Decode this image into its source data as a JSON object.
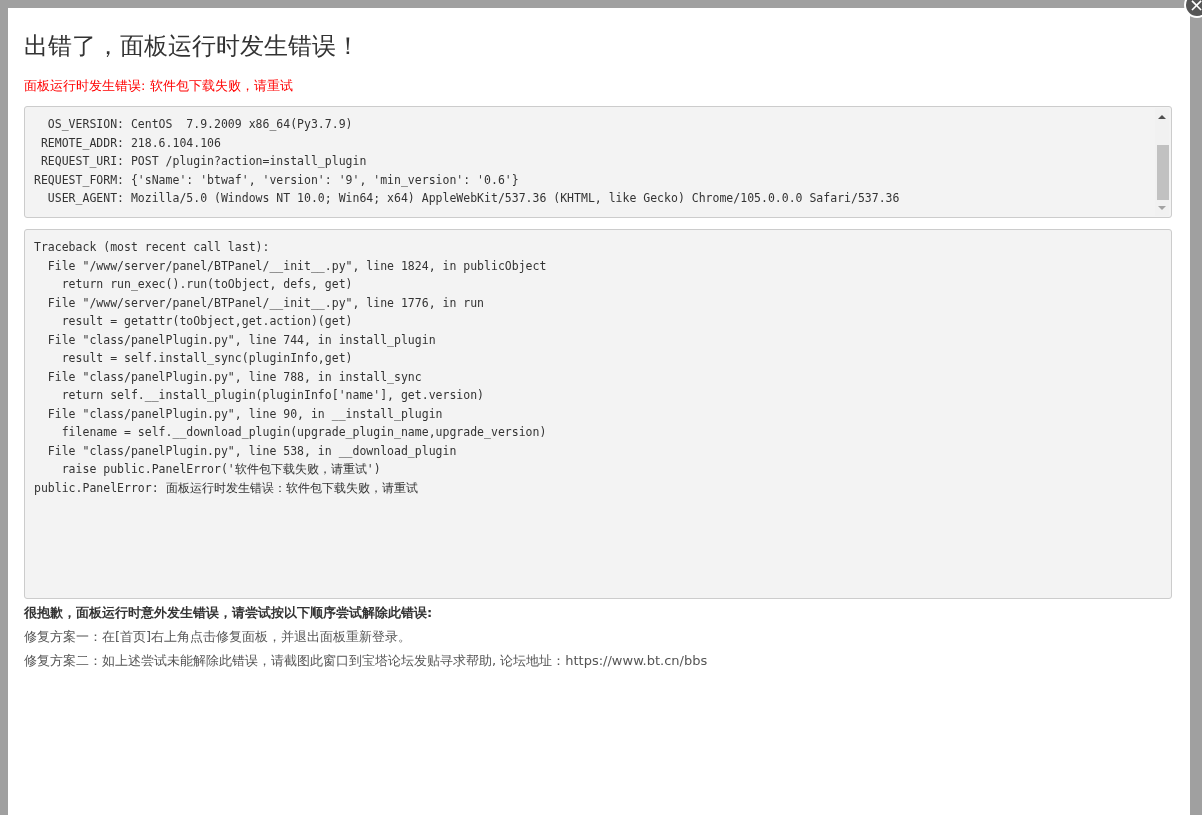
{
  "dialog": {
    "title": "出错了，面板运行时发生错误！",
    "error_message": "面板运行时发生错误: 软件包下载失败，请重试",
    "close_button": "×",
    "request_info": [
      "  OS_VERSION: CentOS  7.9.2009 x86_64(Py3.7.9)",
      " REMOTE_ADDR: 218.6.104.106",
      " REQUEST_URI: POST /plugin?action=install_plugin",
      "REQUEST_FORM: {'sName': 'btwaf', 'version': '9', 'min_version': '0.6'}",
      "  USER_AGENT: Mozilla/5.0 (Windows NT 10.0; Win64; x64) AppleWebKit/537.36 (KHTML, like Gecko) Chrome/105.0.0.0 Safari/537.36"
    ],
    "traceback": [
      "Traceback (most recent call last):",
      "  File \"/www/server/panel/BTPanel/__init__.py\", line 1824, in publicObject",
      "    return run_exec().run(toObject, defs, get)",
      "  File \"/www/server/panel/BTPanel/__init__.py\", line 1776, in run",
      "    result = getattr(toObject,get.action)(get)",
      "  File \"class/panelPlugin.py\", line 744, in install_plugin",
      "    result = self.install_sync(pluginInfo,get)",
      "  File \"class/panelPlugin.py\", line 788, in install_sync",
      "    return self.__install_plugin(pluginInfo['name'], get.version)",
      "  File \"class/panelPlugin.py\", line 90, in __install_plugin",
      "    filename = self.__download_plugin(upgrade_plugin_name,upgrade_version)",
      "  File \"class/panelPlugin.py\", line 538, in __download_plugin",
      "    raise public.PanelError('软件包下载失败，请重试')",
      "public.PanelError: 面板运行时发生错误：软件包下载失败，请重试"
    ],
    "help_heading": "很抱歉，面板运行时意外发生错误，请尝试按以下顺序尝试解除此错误:",
    "help_lines": [
      "修复方案一：在[首页]右上角点击修复面板，并退出面板重新登录。",
      "修复方案二：如上述尝试未能解除此错误，请截图此窗口到宝塔论坛发贴寻求帮助, 论坛地址：https://www.bt.cn/bbs"
    ]
  }
}
